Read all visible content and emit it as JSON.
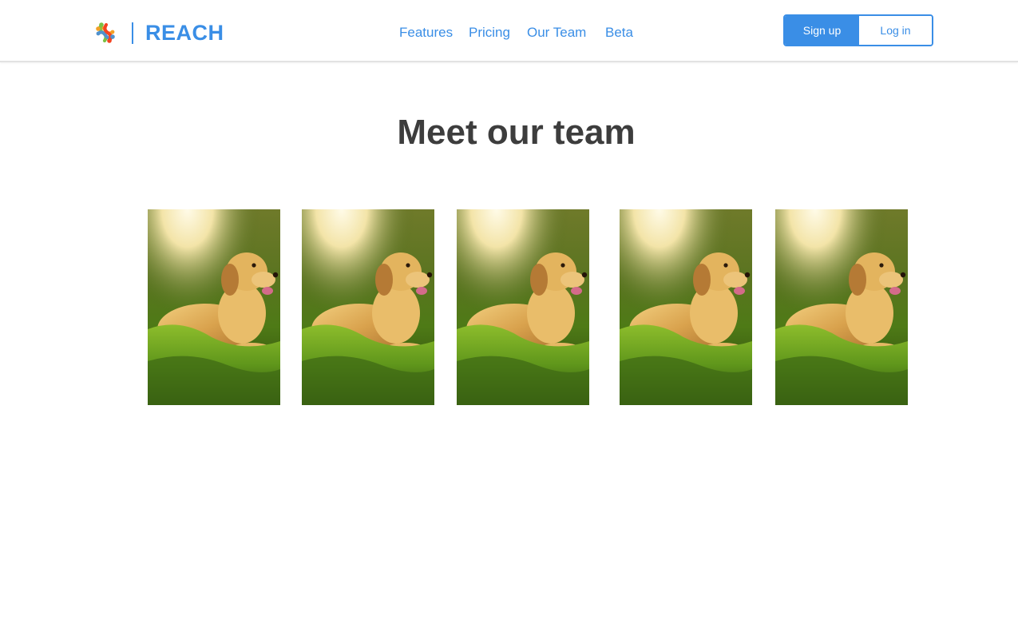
{
  "header": {
    "brand": "REACH",
    "logo_icon": "joomla-style-logo-icon",
    "nav": [
      {
        "label": "Features"
      },
      {
        "label": "Pricing"
      },
      {
        "label": "Our Team"
      },
      {
        "label": "Beta"
      }
    ],
    "signup_label": "Sign up",
    "login_label": "Log in"
  },
  "main": {
    "title": "Meet our team",
    "team_photos": [
      {
        "subject": "golden retriever on grass"
      },
      {
        "subject": "golden retriever on grass"
      },
      {
        "subject": "golden retriever on grass"
      },
      {
        "subject": "golden retriever on grass"
      },
      {
        "subject": "golden retriever on grass"
      }
    ]
  },
  "colors": {
    "brand_blue": "#3a8ee6",
    "title_text": "#3d3d3d",
    "header_border": "#e2e2e2"
  }
}
